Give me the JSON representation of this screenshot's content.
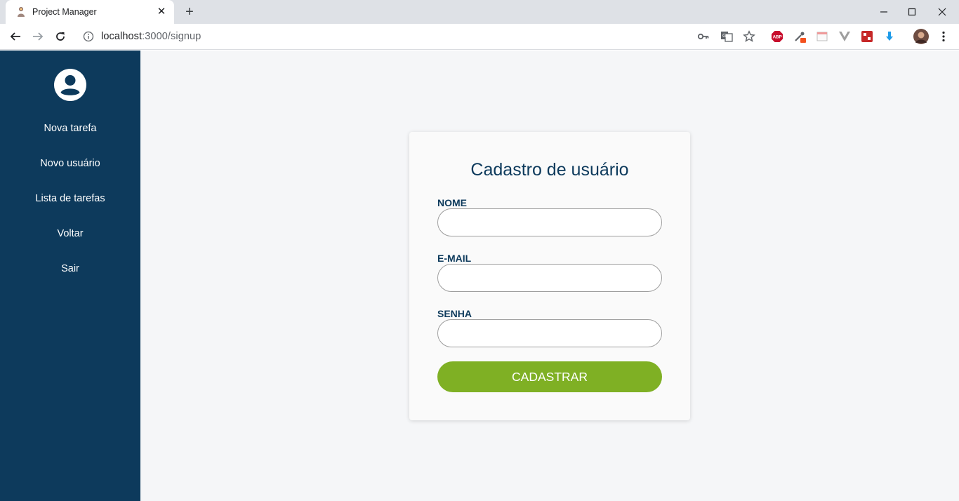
{
  "browser": {
    "tab_title": "Project Manager",
    "url_host": "localhost",
    "url_path": ":3000/signup"
  },
  "sidebar": {
    "items": [
      {
        "label": "Nova tarefa"
      },
      {
        "label": "Novo usuário"
      },
      {
        "label": "Lista de tarefas"
      },
      {
        "label": "Voltar"
      },
      {
        "label": "Sair"
      }
    ]
  },
  "form": {
    "title": "Cadastro de usuário",
    "name_label": "NOME",
    "name_value": "",
    "email_label": "E-MAIL",
    "email_value": "",
    "password_label": "SENHA",
    "password_value": "",
    "submit_label": "CADASTRAR"
  },
  "colors": {
    "sidebar": "#0d3a5c",
    "accent": "#7fb024",
    "background": "#f5f6f8"
  },
  "icons": {
    "avatar": "account-circle-icon",
    "extensions": [
      "key-icon",
      "translate-icon",
      "star-icon",
      "adblock-icon",
      "eyedropper-icon",
      "window-icon",
      "vue-icon",
      "puzzle-icon",
      "download-icon",
      "profile-avatar-icon",
      "menu-icon"
    ]
  }
}
